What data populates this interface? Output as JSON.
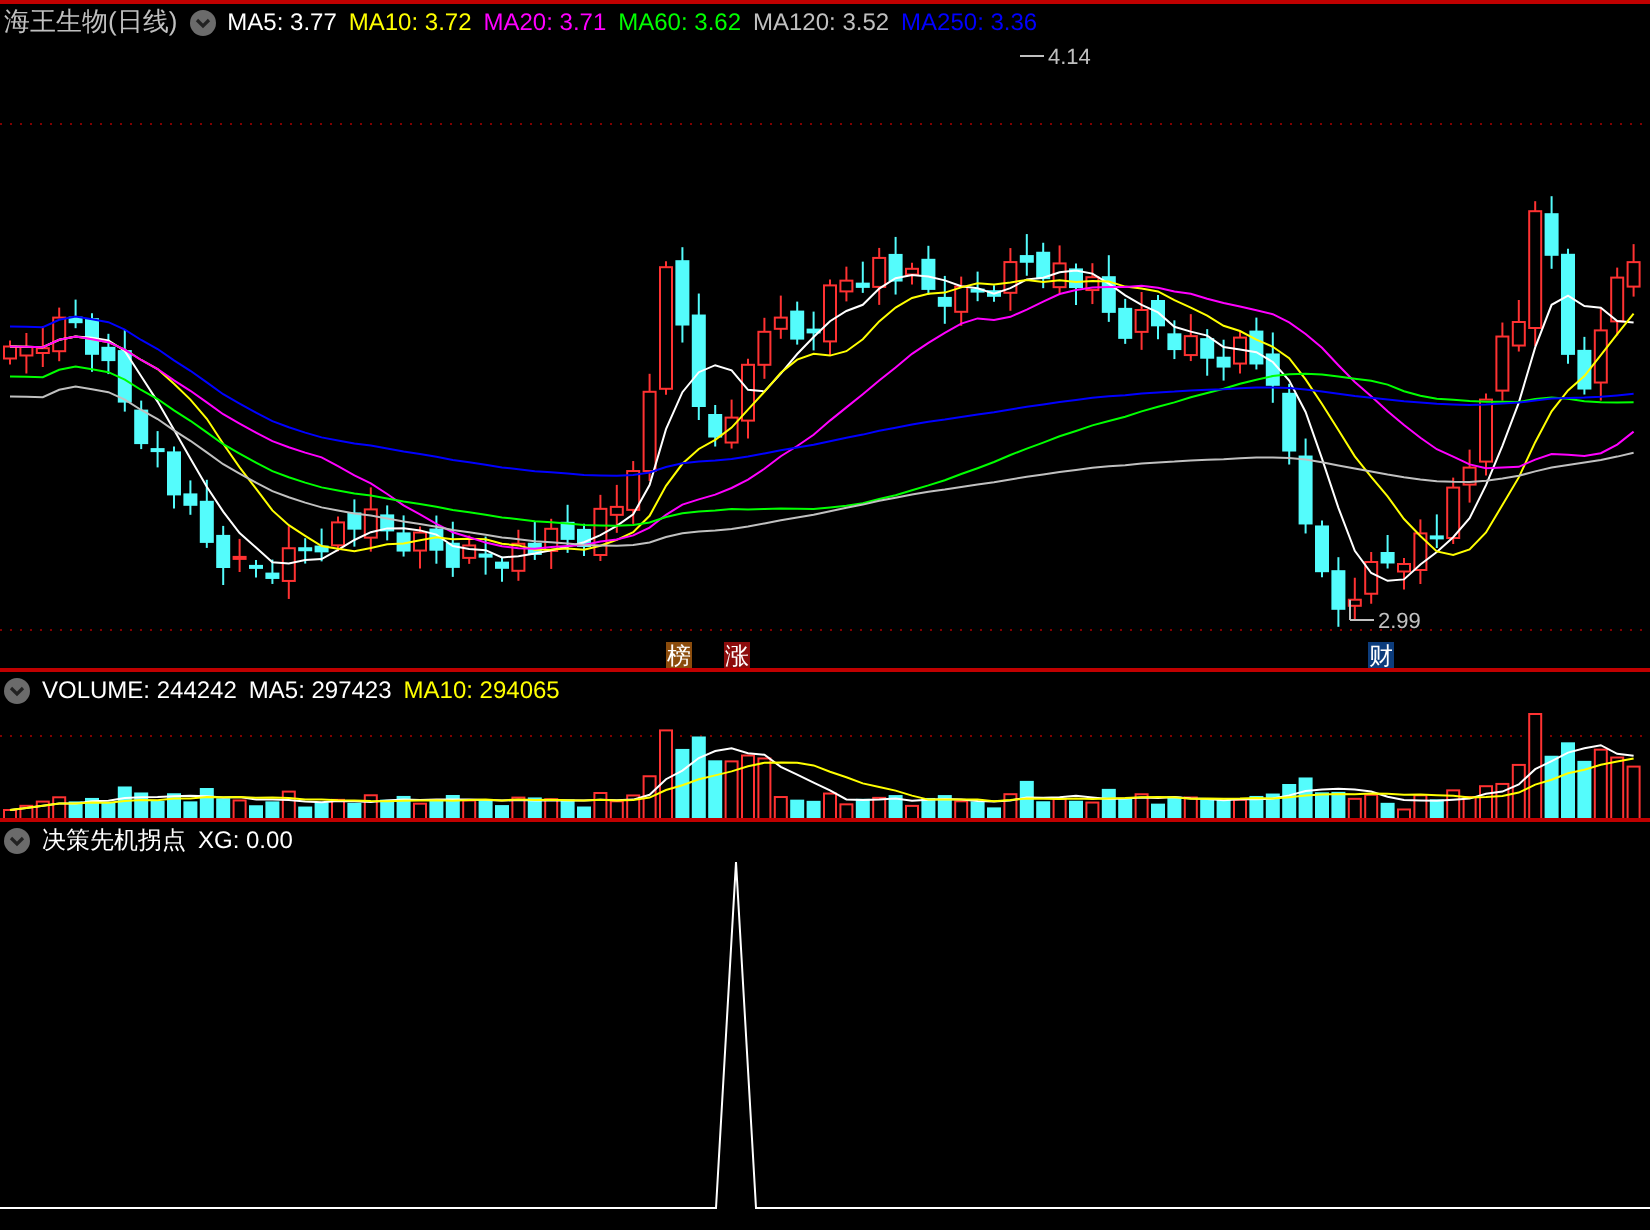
{
  "title": "海王生物(日线)",
  "main_legend": [
    {
      "label": "MA5: 3.77",
      "color": "#ffffff"
    },
    {
      "label": "MA10: 3.72",
      "color": "#ffff00"
    },
    {
      "label": "MA20: 3.71",
      "color": "#ff00ff"
    },
    {
      "label": "MA60: 3.62",
      "color": "#00ff00"
    },
    {
      "label": "MA120: 3.52",
      "color": "#c0c0c0"
    },
    {
      "label": "MA250: 3.36",
      "color": "#0000ff"
    }
  ],
  "price_labels": [
    {
      "text": "4.14",
      "kind": "high"
    },
    {
      "text": "2.99",
      "kind": "low"
    }
  ],
  "markers": [
    {
      "text": "榜",
      "color": "#8b4c0c"
    },
    {
      "text": "涨",
      "color": "#8c0c0c"
    },
    {
      "text": "财",
      "color": "#0c3c7c"
    }
  ],
  "volume_legend": [
    {
      "label": "VOLUME: 244242",
      "color": "#ffffff"
    },
    {
      "label": "MA5: 297423",
      "color": "#ffffff"
    },
    {
      "label": "MA10: 294065",
      "color": "#ffff00"
    }
  ],
  "indicator_legend": [
    {
      "label": "决策先机拐点",
      "color": "#ffffff"
    },
    {
      "label": "XG: 0.00",
      "color": "#ffffff"
    }
  ]
}
